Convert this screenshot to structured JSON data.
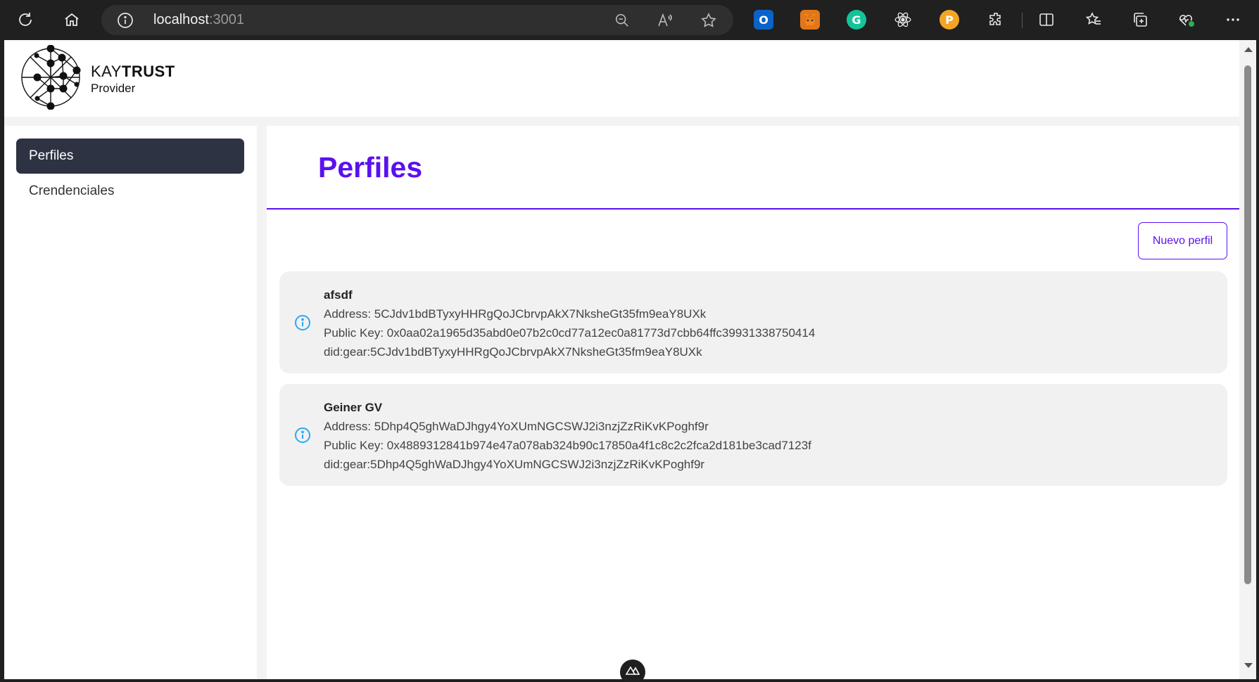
{
  "browser": {
    "url_host": "localhost",
    "url_port": ":3001"
  },
  "brand": {
    "name_light": "KAY",
    "name_bold": "TRUST",
    "subtitle": "Provider"
  },
  "sidebar": {
    "items": [
      {
        "label": "Perfiles",
        "active": true
      },
      {
        "label": "Crendenciales",
        "active": false
      }
    ]
  },
  "main": {
    "title": "Perfiles",
    "new_button": "Nuevo perfil",
    "profiles": [
      {
        "name": "afsdf",
        "address": "Address: 5CJdv1bdBTyxyHHRgQoJCbrvpAkX7NksheGt35fm9eaY8UXk",
        "public_key": "Public Key: 0x0aa02a1965d35abd0e07b2c0cd77a12ec0a81773d7cbb64ffc39931338750414",
        "did": "did:gear:5CJdv1bdBTyxyHHRgQoJCbrvpAkX7NksheGt35fm9eaY8UXk"
      },
      {
        "name": "Geiner GV",
        "address": "Address: 5Dhp4Q5ghWaDJhgy4YoXUmNGCSWJ2i3nzjZzRiKvKPoghf9r",
        "public_key": "Public Key: 0x4889312841b974e47a078ab324b90c17850a4f1c8c2c2fca2d181be3cad7123f",
        "did": "did:gear:5Dhp4Q5ghWaDJhgy4YoXUmNGCSWJ2i3nzjZzRiKvKPoghf9r"
      }
    ]
  },
  "colors": {
    "accent": "#5b10f0",
    "active_nav": "#2d3343",
    "card_bg": "#f1f1f2",
    "info_icon": "#2aa9f5"
  },
  "icons": [
    "refresh-icon",
    "home-icon",
    "info-icon",
    "zoom-out-icon",
    "read-aloud-icon",
    "favorite-star-icon",
    "outlook-icon",
    "metamask-icon",
    "grammarly-icon",
    "react-devtools-icon",
    "polkadot-icon",
    "extensions-icon",
    "split-screen-icon",
    "favorites-icon",
    "collections-icon",
    "browser-essentials-icon",
    "more-icon",
    "nuxt-devtools-icon"
  ]
}
